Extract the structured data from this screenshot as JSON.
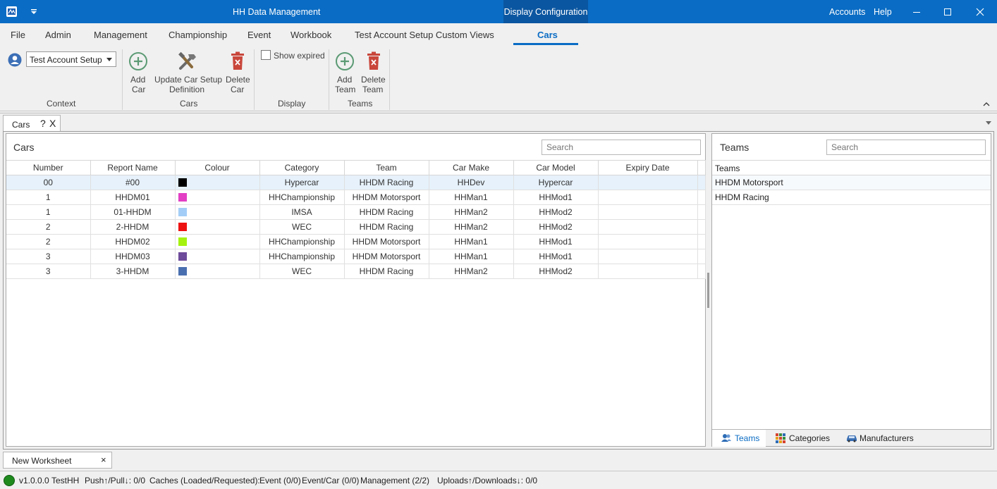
{
  "titlebar": {
    "title": "HH Data Management",
    "context_tab": "Display Configuration",
    "accounts": "Accounts",
    "help": "Help"
  },
  "menu": {
    "file": "File",
    "admin": "Admin",
    "management": "Management",
    "championship": "Championship",
    "event": "Event",
    "workbook": "Workbook",
    "custom_views": "Test Account Setup Custom Views",
    "cars": "Cars"
  },
  "ribbon": {
    "context_select": "Test Account Setup",
    "context_label": "Context",
    "add_car": [
      "Add",
      "Car"
    ],
    "update_car": [
      "Update Car Setup",
      "Definition"
    ],
    "delete_car": [
      "Delete",
      "Car"
    ],
    "cars_label": "Cars",
    "show_expired": "Show expired",
    "display_label": "Display",
    "add_team": [
      "Add",
      "Team"
    ],
    "delete_team": [
      "Delete",
      "Team"
    ],
    "teams_label": "Teams"
  },
  "doctab": {
    "cars": "Cars",
    "help": "?",
    "close": "X"
  },
  "cars_panel": {
    "title": "Cars",
    "search_placeholder": "Search",
    "columns": [
      "Number",
      "Report Name",
      "Colour",
      "Category",
      "Team",
      "Car Make",
      "Car Model",
      "Expiry Date"
    ],
    "rows": [
      {
        "number": "00",
        "report": "#00",
        "colour": "#000000",
        "category": "Hypercar",
        "team": "HHDM Racing",
        "make": "HHDev",
        "model": "Hypercar",
        "expiry": ""
      },
      {
        "number": "1",
        "report": "HHDM01",
        "colour": "#e23fc4",
        "category": "HHChampionship",
        "team": "HHDM Motorsport",
        "make": "HHMan1",
        "model": "HHMod1",
        "expiry": ""
      },
      {
        "number": "1",
        "report": "01-HHDM",
        "colour": "#a3cdf7",
        "category": "IMSA",
        "team": "HHDM Racing",
        "make": "HHMan2",
        "model": "HHMod2",
        "expiry": ""
      },
      {
        "number": "2",
        "report": "2-HHDM",
        "colour": "#ee1111",
        "category": "WEC",
        "team": "HHDM Racing",
        "make": "HHMan2",
        "model": "HHMod2",
        "expiry": ""
      },
      {
        "number": "2",
        "report": "HHDM02",
        "colour": "#a5f20f",
        "category": "HHChampionship",
        "team": "HHDM Motorsport",
        "make": "HHMan1",
        "model": "HHMod1",
        "expiry": ""
      },
      {
        "number": "3",
        "report": "HHDM03",
        "colour": "#6e4b9b",
        "category": "HHChampionship",
        "team": "HHDM Motorsport",
        "make": "HHMan1",
        "model": "HHMod1",
        "expiry": ""
      },
      {
        "number": "3",
        "report": "3-HHDM",
        "colour": "#4a6fb0",
        "category": "WEC",
        "team": "HHDM Racing",
        "make": "HHMan2",
        "model": "HHMod2",
        "expiry": ""
      }
    ]
  },
  "teams_panel": {
    "title": "Teams",
    "search_placeholder": "Search",
    "column": "Teams",
    "rows": [
      "HHDM Motorsport",
      "HHDM Racing"
    ],
    "bottom_tabs": {
      "teams": "Teams",
      "categories": "Categories",
      "manufacturers": "Manufacturers"
    }
  },
  "worksheet_tab": {
    "label": "New Worksheet",
    "close": "×"
  },
  "status": {
    "version": "v1.0.0.0",
    "user": "TestHH",
    "pushpull": "Push↑/Pull↓: 0/0",
    "caches": "Caches (Loaded/Requested):",
    "event": "Event (0/0)",
    "eventcar": "Event/Car (0/0)",
    "management": "Management (2/2)",
    "uploads": "Uploads↑/Downloads↓: 0/0"
  },
  "colors": {
    "titlebar": "#0a6cc4",
    "context_tab": "#0b56a0",
    "accent": "#0a6cc4",
    "status_ok": "#1e8a1e"
  }
}
